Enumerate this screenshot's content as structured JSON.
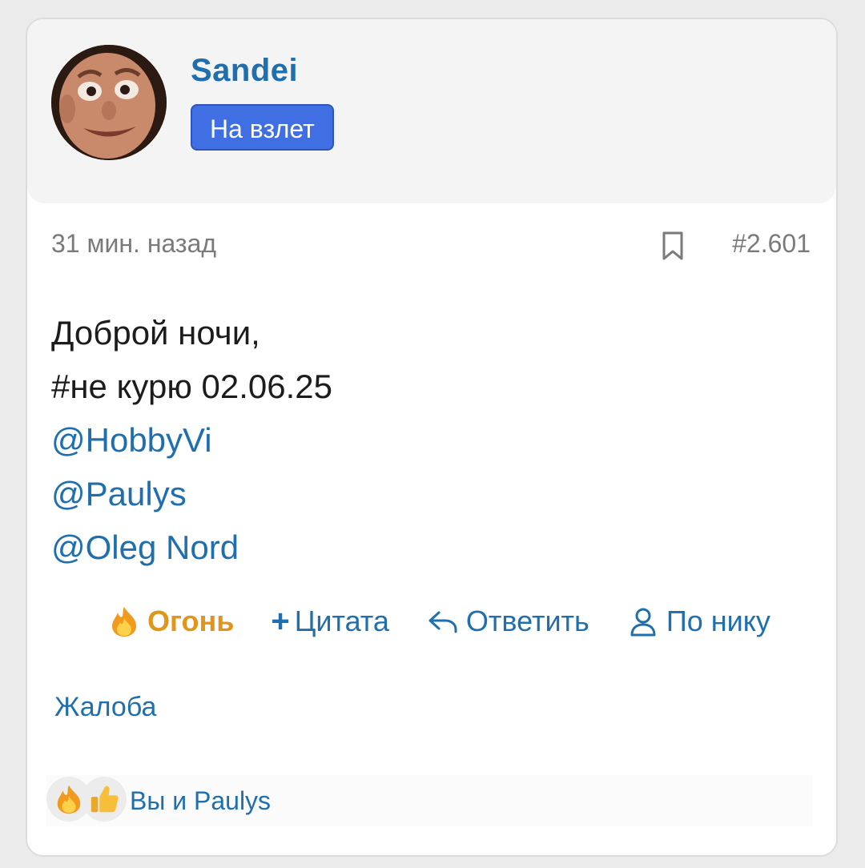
{
  "user": {
    "name": "Sandei",
    "badge": "На взлет",
    "avatar_icon": "face-avatar"
  },
  "post": {
    "time": "31 мин. назад",
    "number": "#2.601",
    "lines": [
      "Доброй ночи,",
      "#не курю 02.06.25"
    ],
    "mentions": [
      "@HobbyVi",
      "@Paulys",
      "@Oleg Nord"
    ]
  },
  "actions": {
    "fire": "Огонь",
    "quote": "Цитата",
    "reply": "Ответить",
    "by_nick": "По нику",
    "complaint": "Жалоба"
  },
  "reactions": {
    "icons": [
      "fire-icon",
      "thumbs-up-icon"
    ],
    "text": "Вы и Paulys"
  },
  "colors": {
    "accent": "#1f6fae",
    "badge": "#3f6fe2",
    "fire": "#e0961a"
  }
}
